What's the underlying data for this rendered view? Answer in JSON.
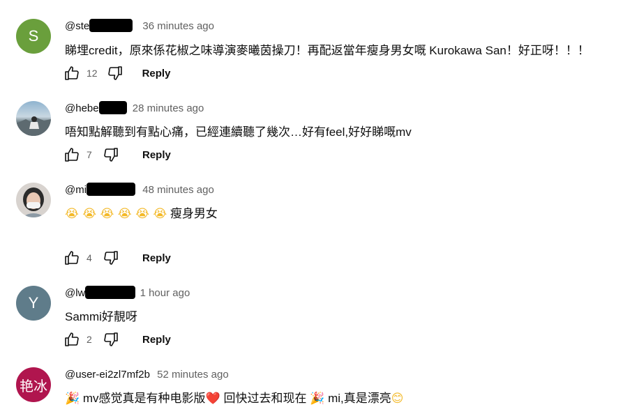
{
  "comments": [
    {
      "avatar_letter": "S",
      "avatar_color": "#6a9f3c",
      "handle": "@ste",
      "time": "36 minutes ago",
      "text": "睇埋credit，原來係花椒之味導演麥曦茵操刀！再配返當年瘦身男女嘅 Kurokawa San！好正呀！！！",
      "likes": "12",
      "reply": "Reply"
    },
    {
      "avatar_letter": "",
      "handle": "@hebe",
      "time": "28 minutes ago",
      "text": "唔知點解聽到有點心痛，已經連續聽了幾次…好有feel,好好睇嘅mv",
      "likes": "7",
      "reply": "Reply"
    },
    {
      "avatar_letter": "",
      "handle": "@mi",
      "time": "48 minutes ago",
      "emojis": "😭 😭 😭 😭 😭 😭",
      "text": "瘦身男女",
      "likes": "4",
      "reply": "Reply"
    },
    {
      "avatar_letter": "Y",
      "avatar_color": "#5f7c8a",
      "handle": "@lw",
      "time": "1 hour ago",
      "text": "Sammi好靚呀",
      "likes": "2",
      "reply": "Reply"
    },
    {
      "avatar_letter": "艳冰",
      "avatar_color": "#b0154e",
      "handle": "@user-ei2zl7mf2b",
      "time": "52 minutes ago",
      "text_parts": [
        "🎉",
        " mv感觉真是有种电影版",
        "❤️",
        " 回快过去和现在 ",
        "🎉",
        " mi,真是漂亮",
        "😊"
      ]
    }
  ]
}
